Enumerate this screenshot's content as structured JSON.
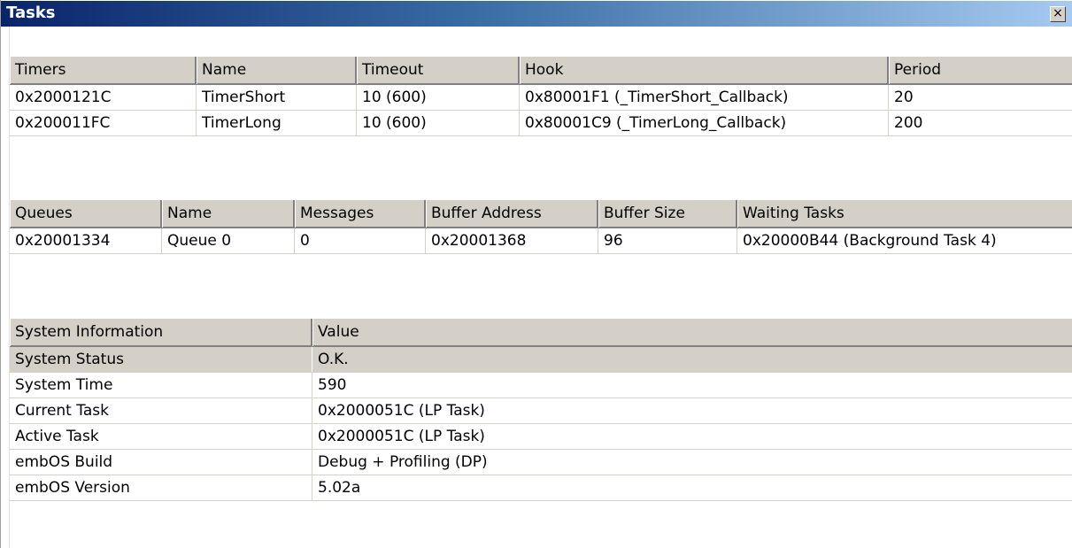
{
  "window": {
    "title": "Tasks",
    "close_glyph": "×"
  },
  "timers": {
    "headers": [
      "Timers",
      "Name",
      "Timeout",
      "Hook",
      "Period"
    ],
    "rows": [
      [
        "0x2000121C",
        "TimerShort",
        "10 (600)",
        "0x80001F1 (_TimerShort_Callback)",
        "20"
      ],
      [
        "0x200011FC",
        "TimerLong",
        "10 (600)",
        "0x80001C9 (_TimerLong_Callback)",
        "200"
      ]
    ]
  },
  "queues": {
    "headers": [
      "Queues",
      "Name",
      "Messages",
      "Buffer Address",
      "Buffer Size",
      "Waiting Tasks"
    ],
    "rows": [
      [
        "0x20001334",
        "Queue 0",
        "0",
        "0x20001368",
        "96",
        "0x20000B44 (Background Task 4)"
      ]
    ]
  },
  "system_info": {
    "headers": [
      "System Information",
      "Value"
    ],
    "rows": [
      [
        "System Status",
        "O.K."
      ],
      [
        "System Time",
        "590"
      ],
      [
        "Current Task",
        "0x2000051C (LP Task)"
      ],
      [
        "Active Task",
        "0x2000051C (LP Task)"
      ],
      [
        "embOS Build",
        "Debug + Profiling (DP)"
      ],
      [
        "embOS Version",
        "5.02a"
      ]
    ],
    "selected_row": "System Status"
  },
  "icons": {
    "close": "close-icon"
  }
}
